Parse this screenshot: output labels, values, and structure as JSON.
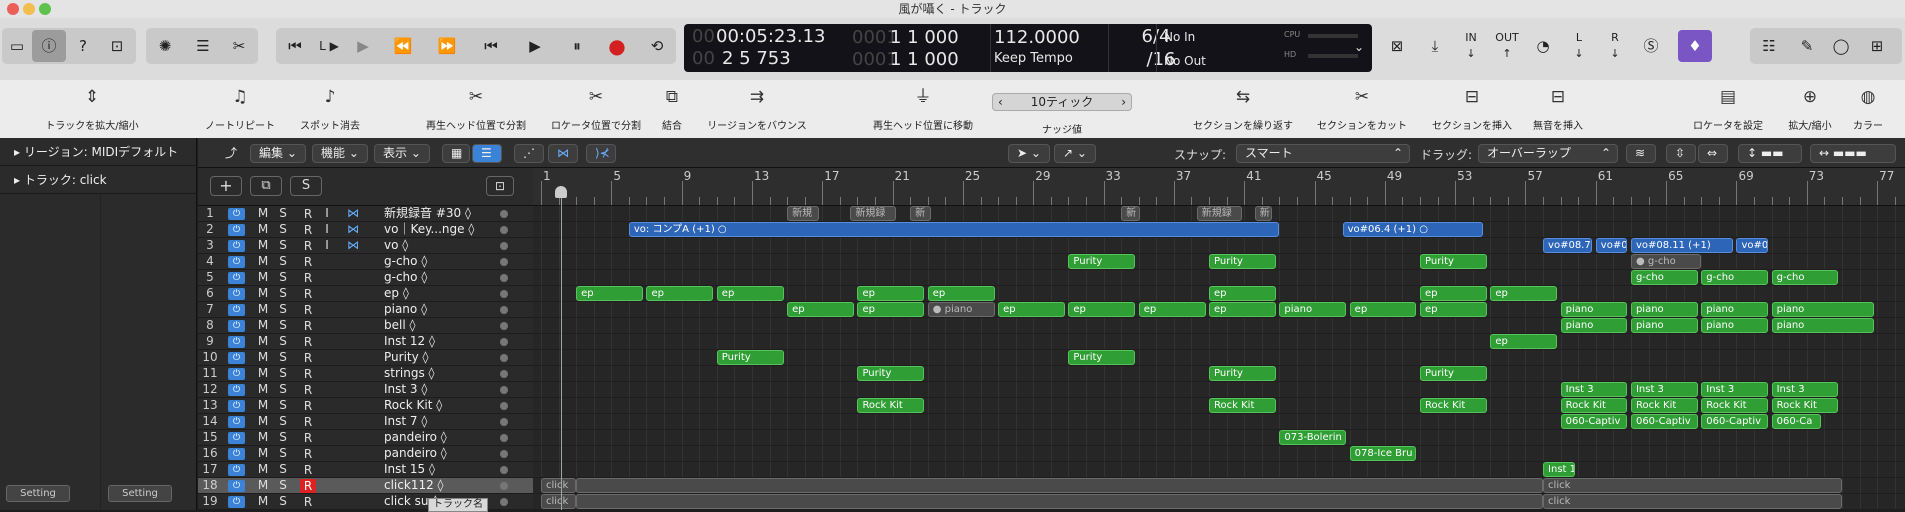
{
  "window": {
    "title": "風が囁く - トラック"
  },
  "lcd": {
    "time": "00:05:23.13",
    "bars": "2 5 753",
    "pos_a": "1 1 000",
    "pos_b": "1 1 000",
    "pos_a_prefix": "0001",
    "pos_b_prefix": "0001",
    "time_prefix": "00",
    "bars_prefix": "00",
    "tempo": "112.0000",
    "tempo_mode": "Keep Tempo",
    "sig": "6/4",
    "div": "/16",
    "in": "No In",
    "out": "No Out",
    "cpu": "CPU",
    "hd": "HD"
  },
  "control": {
    "l": "L",
    "r": "R",
    "in": "IN",
    "out": "OUT"
  },
  "toolbar": {
    "items": [
      "トラックを拡大/縮小",
      "ノートリピート",
      "スポット消去",
      "再生ヘッド位置で分割",
      "ロケータ位置で分割",
      "結合",
      "リージョンをバウンス",
      "再生ヘッド位置に移動",
      "ナッジ値",
      "セクションを繰り返す",
      "セクションをカット",
      "セクションを挿入",
      "無音を挿入",
      "ロケータを設定",
      "拡大/縮小",
      "カラー"
    ],
    "nudge": "10ティック"
  },
  "inspector": {
    "region": "リージョン: MIDIデフォルト",
    "track": "トラック: click",
    "setting": "Setting"
  },
  "editor": {
    "edit": "編集",
    "func": "機能",
    "view": "表示",
    "snap_label": "スナップ:",
    "snap": "スマート",
    "drag_label": "ドラッグ:",
    "drag": "オーバーラップ"
  },
  "trackhdr": {
    "add": "+",
    "s": "S"
  },
  "ruler": [
    "1",
    "5",
    "9",
    "13",
    "17",
    "21",
    "25",
    "29",
    "33",
    "37",
    "41",
    "45",
    "49",
    "53",
    "57",
    "61",
    "65",
    "69",
    "73",
    "77"
  ],
  "tracks": [
    {
      "n": "1",
      "name": "新規録音 #30",
      "m": "M",
      "s": "S",
      "r": "R",
      "i": "I"
    },
    {
      "n": "2",
      "name": "vo｜Key...nge",
      "m": "M",
      "s": "S",
      "r": "R",
      "i": "I"
    },
    {
      "n": "3",
      "name": "vo",
      "m": "M",
      "s": "S",
      "r": "R",
      "i": "I"
    },
    {
      "n": "4",
      "name": "g-cho",
      "m": "M",
      "s": "S",
      "r": "R",
      "i": ""
    },
    {
      "n": "5",
      "name": "g-cho",
      "m": "M",
      "s": "S",
      "r": "R",
      "i": ""
    },
    {
      "n": "6",
      "name": "ep",
      "m": "M",
      "s": "S",
      "r": "R",
      "i": ""
    },
    {
      "n": "7",
      "name": "piano",
      "m": "M",
      "s": "S",
      "r": "R",
      "i": ""
    },
    {
      "n": "8",
      "name": "bell",
      "m": "M",
      "s": "S",
      "r": "R",
      "i": ""
    },
    {
      "n": "9",
      "name": "Inst 12",
      "m": "M",
      "s": "S",
      "r": "R",
      "i": ""
    },
    {
      "n": "10",
      "name": "Purity",
      "m": "M",
      "s": "S",
      "r": "R",
      "i": ""
    },
    {
      "n": "11",
      "name": "strings",
      "m": "M",
      "s": "S",
      "r": "R",
      "i": ""
    },
    {
      "n": "12",
      "name": "Inst 3",
      "m": "M",
      "s": "S",
      "r": "R",
      "i": ""
    },
    {
      "n": "13",
      "name": "Rock Kit",
      "m": "M",
      "s": "S",
      "r": "R",
      "i": ""
    },
    {
      "n": "14",
      "name": "Inst 7",
      "m": "M",
      "s": "S",
      "r": "R",
      "i": ""
    },
    {
      "n": "15",
      "name": "pandeiro",
      "m": "M",
      "s": "S",
      "r": "R",
      "i": ""
    },
    {
      "n": "16",
      "name": "pandeiro",
      "m": "M",
      "s": "S",
      "r": "R",
      "i": ""
    },
    {
      "n": "17",
      "name": "Inst 15",
      "m": "M",
      "s": "S",
      "r": "R",
      "i": ""
    },
    {
      "n": "18",
      "name": "click112",
      "m": "M",
      "s": "S",
      "r": "R",
      "i": ""
    },
    {
      "n": "19",
      "name": "click su",
      "m": "M",
      "s": "S",
      "r": "R",
      "i": ""
    }
  ],
  "tooltip": "トラック名",
  "regions": [
    {
      "row": 1,
      "bar": 15,
      "len": 1.8,
      "t": "新規",
      "c": "gr"
    },
    {
      "row": 1,
      "bar": 18.6,
      "len": 2.6,
      "t": "新規録",
      "c": "gr"
    },
    {
      "row": 1,
      "bar": 22,
      "len": 1.2,
      "t": "新",
      "c": "gr"
    },
    {
      "row": 1,
      "bar": 34,
      "len": 1.1,
      "t": "新",
      "c": "gr"
    },
    {
      "row": 1,
      "bar": 38.3,
      "len": 2.6,
      "t": "新規録",
      "c": "gr"
    },
    {
      "row": 1,
      "bar": 41.6,
      "len": 1,
      "t": "新",
      "c": "gr"
    },
    {
      "row": 2,
      "bar": 6,
      "len": 37,
      "t": "vo: コンプA (+1)  ○",
      "c": "b"
    },
    {
      "row": 2,
      "bar": 46.6,
      "len": 8,
      "t": "vo#06.4 (+1)  ○",
      "c": "b"
    },
    {
      "row": 3,
      "bar": 58,
      "len": 2.8,
      "t": "vo#08.7",
      "c": "b"
    },
    {
      "row": 3,
      "bar": 61,
      "len": 1.8,
      "t": "vo#0",
      "c": "b"
    },
    {
      "row": 3,
      "bar": 63,
      "len": 5.8,
      "t": "vo#08.11 (+1)",
      "c": "b"
    },
    {
      "row": 3,
      "bar": 69,
      "len": 1.8,
      "t": "vo#0",
      "c": "b"
    },
    {
      "row": 4,
      "bar": 31,
      "len": 3.8,
      "t": "Purity",
      "c": "g"
    },
    {
      "row": 4,
      "bar": 39,
      "len": 3.8,
      "t": "Purity",
      "c": "g"
    },
    {
      "row": 4,
      "bar": 51,
      "len": 3.8,
      "t": "Purity",
      "c": "g"
    },
    {
      "row": 4,
      "bar": 63,
      "len": 4,
      "t": "● g-cho",
      "c": "gr"
    },
    {
      "row": 5,
      "bar": 63,
      "len": 3.8,
      "t": "g-cho",
      "c": "g"
    },
    {
      "row": 5,
      "bar": 67,
      "len": 3.8,
      "t": "g-cho",
      "c": "g"
    },
    {
      "row": 5,
      "bar": 71,
      "len": 3.8,
      "t": "g-cho",
      "c": "g"
    },
    {
      "row": 6,
      "bar": 3,
      "len": 3.8,
      "t": "ep",
      "c": "g"
    },
    {
      "row": 6,
      "bar": 7,
      "len": 3.8,
      "t": "ep",
      "c": "g"
    },
    {
      "row": 6,
      "bar": 11,
      "len": 3.8,
      "t": "ep",
      "c": "g"
    },
    {
      "row": 6,
      "bar": 19,
      "len": 3.8,
      "t": "ep",
      "c": "g"
    },
    {
      "row": 6,
      "bar": 23,
      "len": 3.8,
      "t": "ep",
      "c": "g"
    },
    {
      "row": 6,
      "bar": 39,
      "len": 3.8,
      "t": "ep",
      "c": "g"
    },
    {
      "row": 6,
      "bar": 51,
      "len": 3.8,
      "t": "ep",
      "c": "g"
    },
    {
      "row": 6,
      "bar": 55,
      "len": 3.8,
      "t": "ep",
      "c": "g"
    },
    {
      "row": 7,
      "bar": 15,
      "len": 3.8,
      "t": "ep",
      "c": "g"
    },
    {
      "row": 7,
      "bar": 19,
      "len": 3.8,
      "t": "ep",
      "c": "g"
    },
    {
      "row": 7,
      "bar": 23,
      "len": 3.8,
      "t": "● piano",
      "c": "gr"
    },
    {
      "row": 7,
      "bar": 27,
      "len": 3.8,
      "t": "ep",
      "c": "g"
    },
    {
      "row": 7,
      "bar": 31,
      "len": 3.8,
      "t": "ep",
      "c": "g"
    },
    {
      "row": 7,
      "bar": 35,
      "len": 3.8,
      "t": "ep",
      "c": "g"
    },
    {
      "row": 7,
      "bar": 39,
      "len": 3.8,
      "t": "ep",
      "c": "g"
    },
    {
      "row": 7,
      "bar": 43,
      "len": 3.8,
      "t": "piano",
      "c": "g"
    },
    {
      "row": 7,
      "bar": 47,
      "len": 3.8,
      "t": "ep",
      "c": "g"
    },
    {
      "row": 7,
      "bar": 51,
      "len": 3.8,
      "t": "ep",
      "c": "g"
    },
    {
      "row": 7,
      "bar": 59,
      "len": 3.8,
      "t": "piano",
      "c": "g"
    },
    {
      "row": 7,
      "bar": 63,
      "len": 3.8,
      "t": "piano",
      "c": "g"
    },
    {
      "row": 7,
      "bar": 67,
      "len": 3.8,
      "t": "piano",
      "c": "g"
    },
    {
      "row": 7,
      "bar": 71,
      "len": 5.8,
      "t": "piano",
      "c": "g"
    },
    {
      "row": 8,
      "bar": 59,
      "len": 3.8,
      "t": "piano",
      "c": "g"
    },
    {
      "row": 8,
      "bar": 63,
      "len": 3.8,
      "t": "piano",
      "c": "g"
    },
    {
      "row": 8,
      "bar": 67,
      "len": 3.8,
      "t": "piano",
      "c": "g"
    },
    {
      "row": 8,
      "bar": 71,
      "len": 5.8,
      "t": "piano",
      "c": "g"
    },
    {
      "row": 9,
      "bar": 55,
      "len": 3.8,
      "t": "ep",
      "c": "g"
    },
    {
      "row": 10,
      "bar": 11,
      "len": 3.8,
      "t": "Purity",
      "c": "g"
    },
    {
      "row": 10,
      "bar": 31,
      "len": 3.8,
      "t": "Purity",
      "c": "g"
    },
    {
      "row": 11,
      "bar": 19,
      "len": 3.8,
      "t": "Purity",
      "c": "g"
    },
    {
      "row": 11,
      "bar": 39,
      "len": 3.8,
      "t": "Purity",
      "c": "g"
    },
    {
      "row": 11,
      "bar": 51,
      "len": 3.8,
      "t": "Purity",
      "c": "g"
    },
    {
      "row": 12,
      "bar": 59,
      "len": 3.8,
      "t": "Inst 3",
      "c": "g"
    },
    {
      "row": 12,
      "bar": 63,
      "len": 3.8,
      "t": "Inst 3",
      "c": "g"
    },
    {
      "row": 12,
      "bar": 67,
      "len": 3.8,
      "t": "Inst 3",
      "c": "g"
    },
    {
      "row": 12,
      "bar": 71,
      "len": 3.8,
      "t": "Inst 3",
      "c": "g"
    },
    {
      "row": 13,
      "bar": 19,
      "len": 3.8,
      "t": "Rock Kit",
      "c": "g"
    },
    {
      "row": 13,
      "bar": 39,
      "len": 3.8,
      "t": "Rock Kit",
      "c": "g"
    },
    {
      "row": 13,
      "bar": 51,
      "len": 3.8,
      "t": "Rock Kit",
      "c": "g"
    },
    {
      "row": 13,
      "bar": 59,
      "len": 3.8,
      "t": "Rock Kit",
      "c": "g"
    },
    {
      "row": 13,
      "bar": 63,
      "len": 3.8,
      "t": "Rock Kit",
      "c": "g"
    },
    {
      "row": 13,
      "bar": 67,
      "len": 3.8,
      "t": "Rock Kit",
      "c": "g"
    },
    {
      "row": 13,
      "bar": 71,
      "len": 3.8,
      "t": "Rock Kit",
      "c": "g"
    },
    {
      "row": 14,
      "bar": 59,
      "len": 3.8,
      "t": "060-Captiv",
      "c": "g"
    },
    {
      "row": 14,
      "bar": 63,
      "len": 3.8,
      "t": "060-Captiv",
      "c": "g"
    },
    {
      "row": 14,
      "bar": 67,
      "len": 3.8,
      "t": "060-Captiv",
      "c": "g"
    },
    {
      "row": 14,
      "bar": 71,
      "len": 2.8,
      "t": "060-Ca",
      "c": "g"
    },
    {
      "row": 15,
      "bar": 43,
      "len": 3.8,
      "t": "073-Bolerin",
      "c": "g"
    },
    {
      "row": 16,
      "bar": 47,
      "len": 3.8,
      "t": "078-Ice Bru",
      "c": "g"
    },
    {
      "row": 17,
      "bar": 58,
      "len": 1.8,
      "t": "Inst 1",
      "c": "g"
    },
    {
      "row": 18,
      "bar": 1,
      "len": 2,
      "t": "click",
      "c": "gr"
    },
    {
      "row": 18,
      "bar": 3,
      "len": 55,
      "t": "",
      "c": "gr"
    },
    {
      "row": 18,
      "bar": 58,
      "len": 17,
      "t": "click",
      "c": "gr"
    },
    {
      "row": 19,
      "bar": 1,
      "len": 2,
      "t": "click",
      "c": "gr"
    },
    {
      "row": 19,
      "bar": 3,
      "len": 55,
      "t": "",
      "c": "gr"
    },
    {
      "row": 19,
      "bar": 58,
      "len": 17,
      "t": "click",
      "c": "gr"
    }
  ]
}
